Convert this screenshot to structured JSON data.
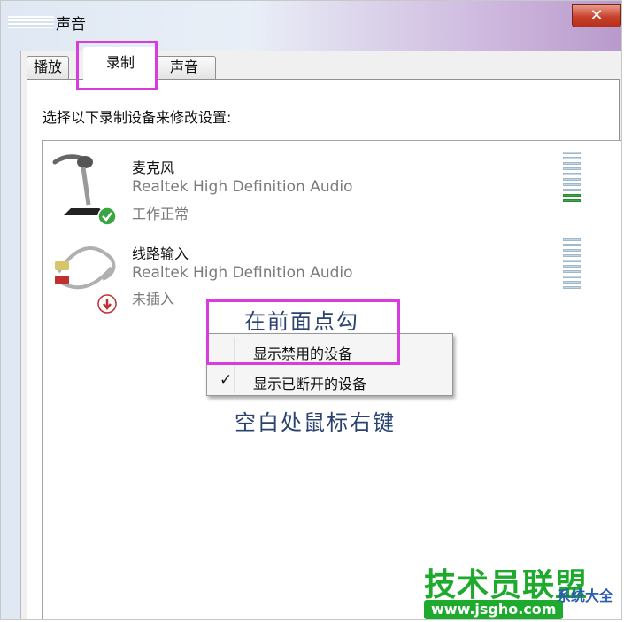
{
  "window": {
    "title": "声音",
    "close_label": "✕"
  },
  "tabs": [
    {
      "label": "播放",
      "selected": false
    },
    {
      "label": "录制",
      "selected": true
    },
    {
      "label": "声音",
      "selected": false
    }
  ],
  "panel": {
    "instruction": "选择以下录制设备来修改设置:"
  },
  "devices": [
    {
      "name": "麦克风",
      "description": "Realtek High Definition Audio",
      "status": "工作正常",
      "icon": "microphone-icon",
      "status_icon": "check-icon",
      "meter_level": 0.2
    },
    {
      "name": "线路输入",
      "description": "Realtek High Definition Audio",
      "status": "未插入",
      "icon": "line-in-cable-icon",
      "status_icon": "unplugged-icon",
      "meter_level": 0
    }
  ],
  "context_menu": {
    "items": [
      {
        "label": "显示禁用的设备",
        "checked": false
      },
      {
        "label": "显示已断开的设备",
        "checked": true
      }
    ]
  },
  "annotations": {
    "hint_check": "在前面点勾",
    "hint_right_click": "空白处鼠标右键"
  },
  "watermark": {
    "text_main": "技术员联盟",
    "text_url": "www.jsgho.com",
    "text_side": "系统大全",
    "colors": {
      "main": "#1eaa2c",
      "url_bg": "#1eaa2c"
    }
  },
  "colors": {
    "highlight": "#d83cdc",
    "annotation": "#2a4370",
    "close_button": "#c6412b"
  }
}
